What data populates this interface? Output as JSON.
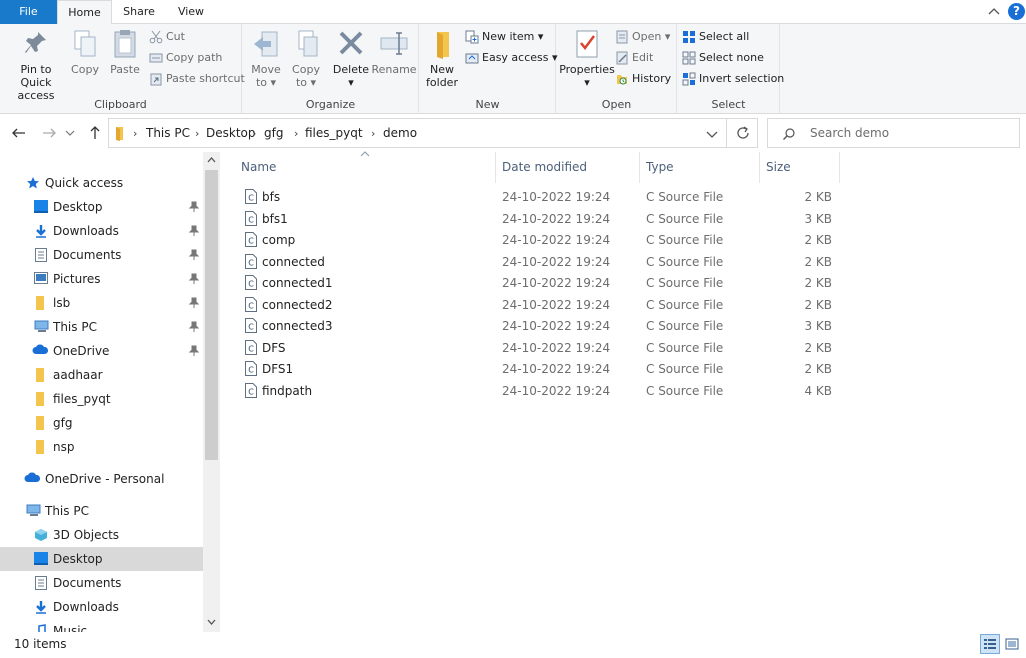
{
  "ribbon_tabs": {
    "file": "File",
    "home": "Home",
    "share": "Share",
    "view": "View"
  },
  "help": "?",
  "clipboard": {
    "pin_line1": "Pin to Quick",
    "pin_line2": "access",
    "copy": "Copy",
    "paste": "Paste",
    "cut": "Cut",
    "copy_path": "Copy path",
    "paste_shortcut": "Paste shortcut",
    "label": "Clipboard"
  },
  "organize": {
    "move_line1": "Move",
    "move_line2": "to",
    "copy_line1": "Copy",
    "copy_line2": "to",
    "delete": "Delete",
    "rename": "Rename",
    "label": "Organize"
  },
  "new_group": {
    "folder_line1": "New",
    "folder_line2": "folder",
    "new_item": "New item",
    "easy_access": "Easy access",
    "label": "New"
  },
  "open_group": {
    "properties": "Properties",
    "open": "Open",
    "edit": "Edit",
    "history": "History",
    "label": "Open"
  },
  "select_group": {
    "select_all": "Select all",
    "select_none": "Select none",
    "invert": "Invert selection",
    "label": "Select"
  },
  "breadcrumb": [
    "This PC",
    "Desktop",
    "gfg",
    "files_pyqt",
    "demo"
  ],
  "search": {
    "placeholder": "Search demo"
  },
  "nav": {
    "quick_access": "Quick access",
    "quick_items": [
      "Desktop",
      "Downloads",
      "Documents",
      "Pictures",
      "lsb",
      "This PC",
      "OneDrive",
      "aadhaar",
      "files_pyqt",
      "gfg",
      "nsp"
    ],
    "onedrive_personal": "OneDrive - Personal",
    "this_pc": "This PC",
    "pc_items": [
      "3D Objects",
      "Desktop",
      "Documents",
      "Downloads",
      "Music"
    ]
  },
  "columns": {
    "name": "Name",
    "date": "Date modified",
    "type": "Type",
    "size": "Size"
  },
  "files": [
    {
      "name": "bfs",
      "date": "24-10-2022 19:24",
      "type": "C Source File",
      "size": "2 KB"
    },
    {
      "name": "bfs1",
      "date": "24-10-2022 19:24",
      "type": "C Source File",
      "size": "3 KB"
    },
    {
      "name": "comp",
      "date": "24-10-2022 19:24",
      "type": "C Source File",
      "size": "2 KB"
    },
    {
      "name": "connected",
      "date": "24-10-2022 19:24",
      "type": "C Source File",
      "size": "2 KB"
    },
    {
      "name": "connected1",
      "date": "24-10-2022 19:24",
      "type": "C Source File",
      "size": "2 KB"
    },
    {
      "name": "connected2",
      "date": "24-10-2022 19:24",
      "type": "C Source File",
      "size": "2 KB"
    },
    {
      "name": "connected3",
      "date": "24-10-2022 19:24",
      "type": "C Source File",
      "size": "3 KB"
    },
    {
      "name": "DFS",
      "date": "24-10-2022 19:24",
      "type": "C Source File",
      "size": "2 KB"
    },
    {
      "name": "DFS1",
      "date": "24-10-2022 19:24",
      "type": "C Source File",
      "size": "2 KB"
    },
    {
      "name": "findpath",
      "date": "24-10-2022 19:24",
      "type": "C Source File",
      "size": "4 KB"
    }
  ],
  "status": {
    "count": "10 items"
  },
  "colors": {
    "accent": "#1979ca",
    "selected": "#d9d9d9",
    "folder": "#f8d775",
    "header_text": "#4c607a"
  }
}
